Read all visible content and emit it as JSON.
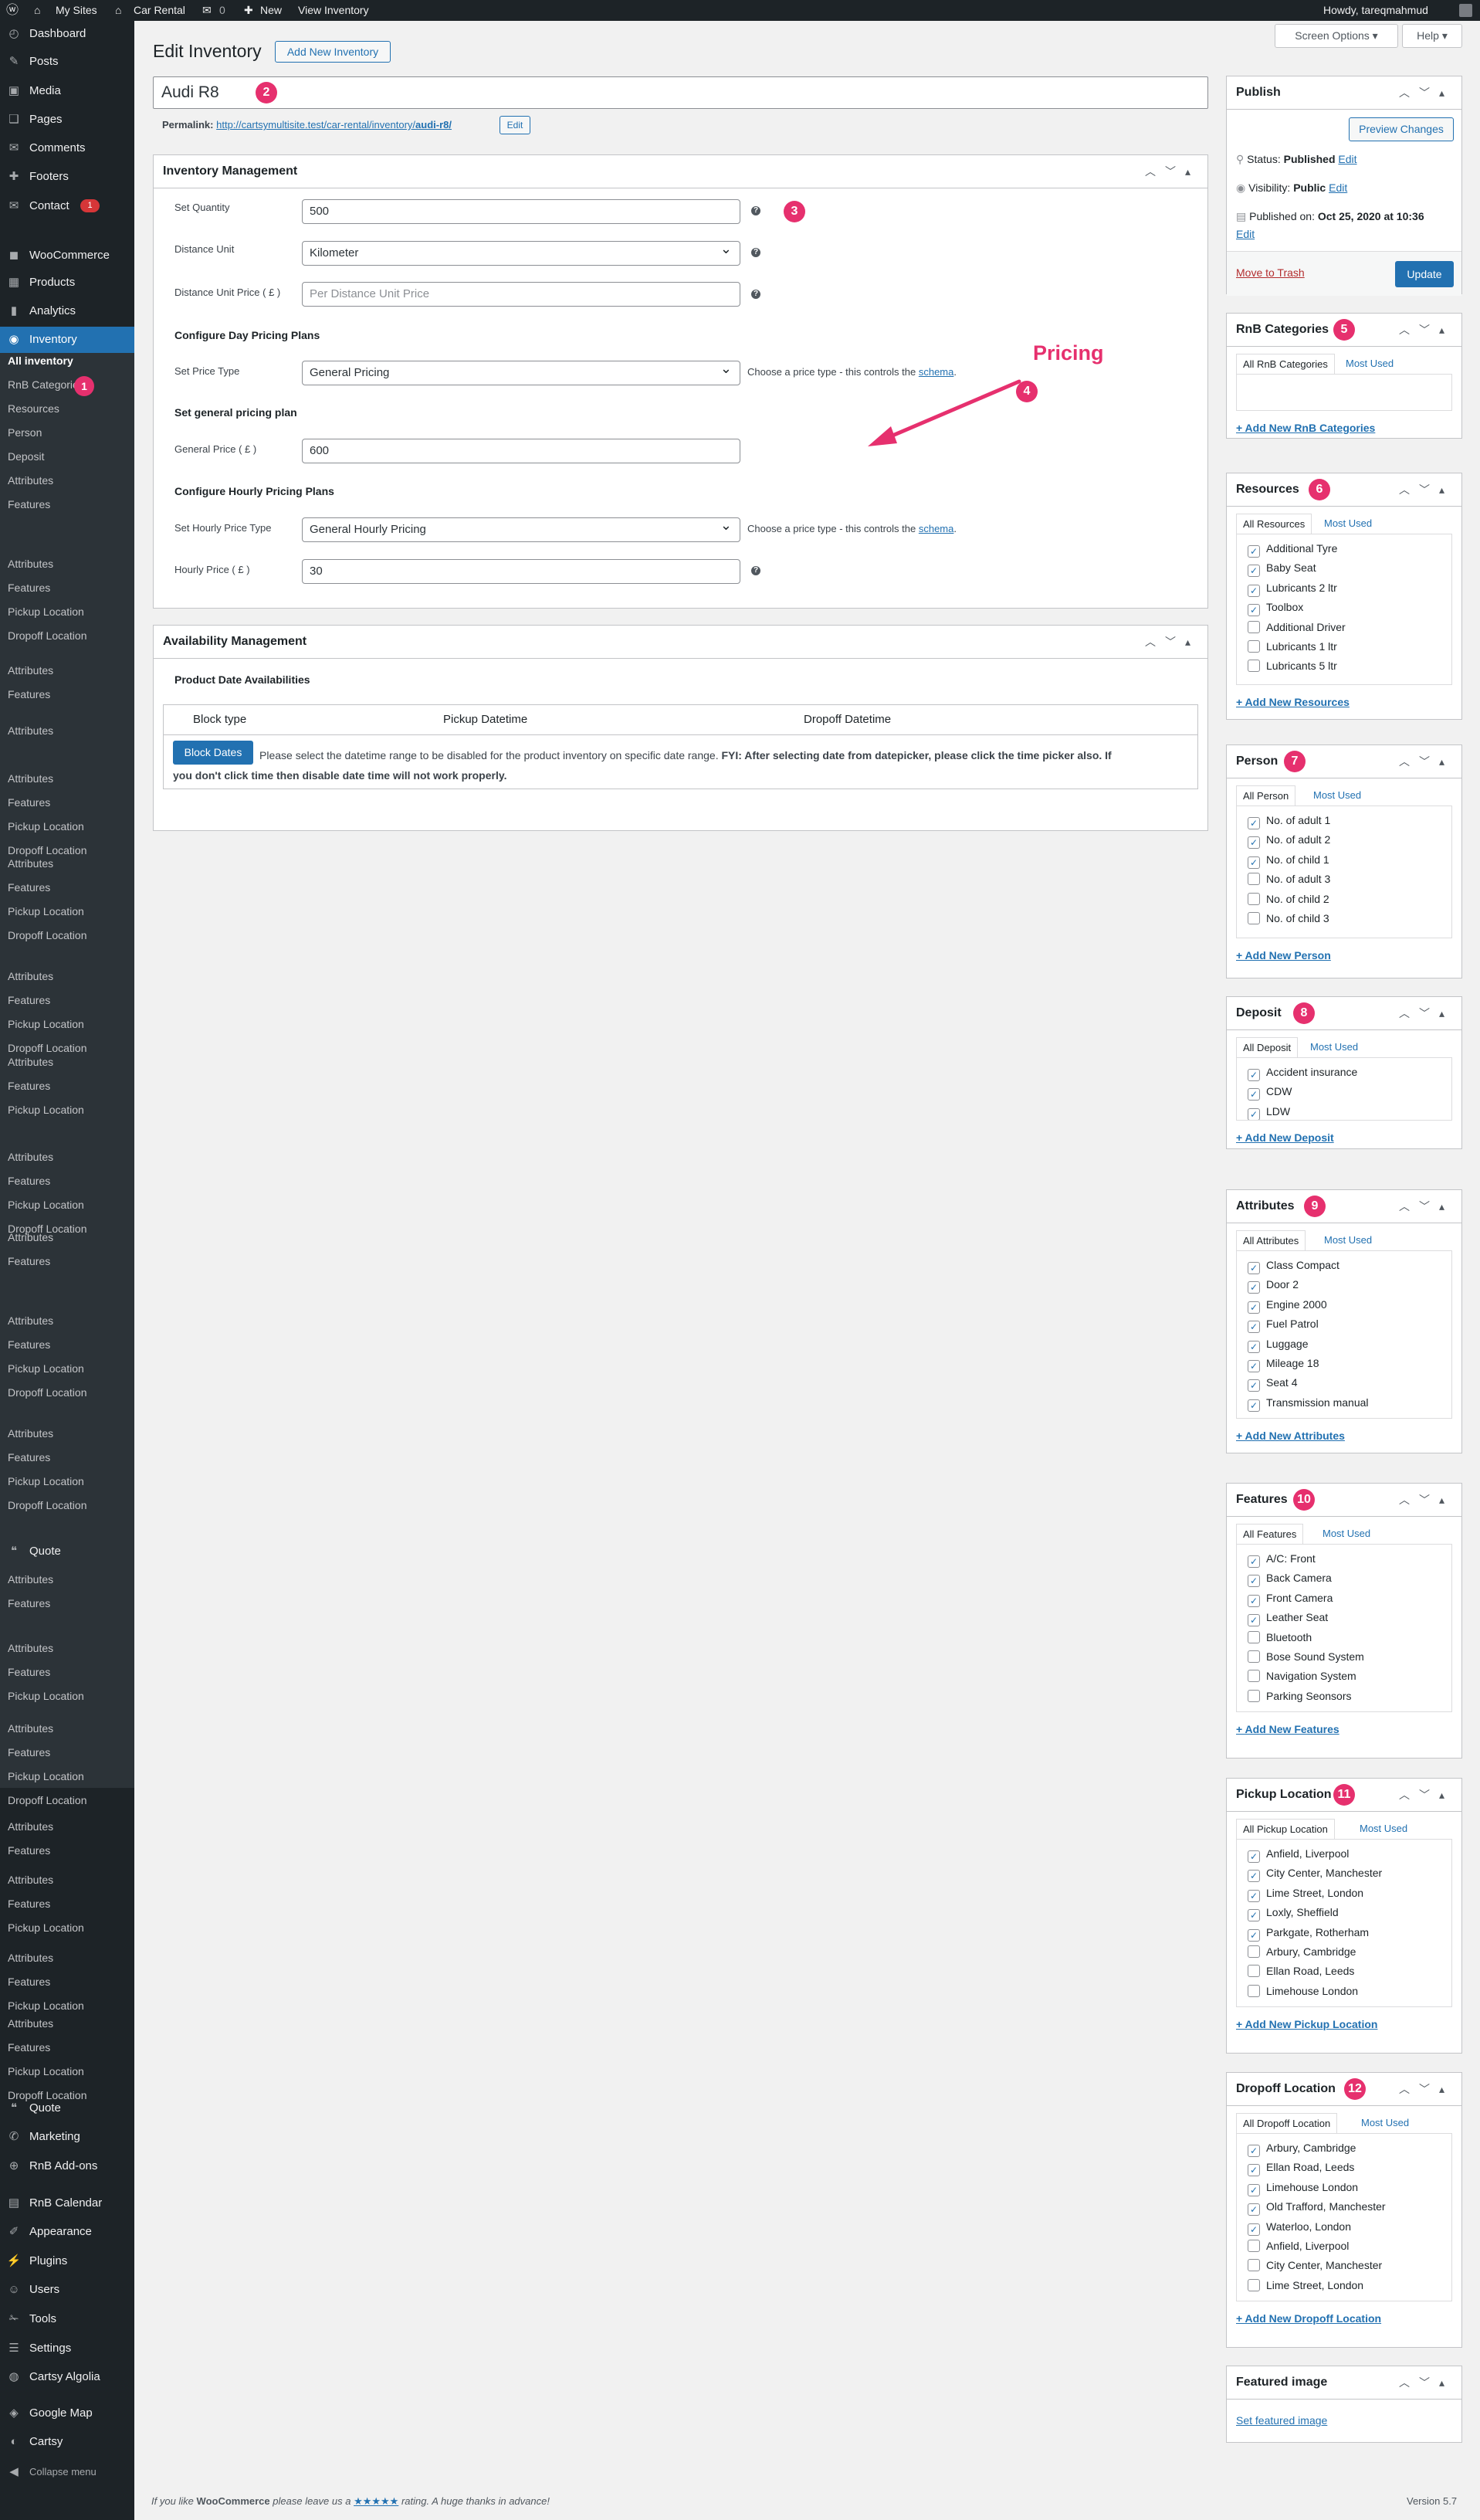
{
  "adminbar": {
    "my_sites": "My Sites",
    "site": "Car Rental",
    "comments": "0",
    "new": "New",
    "view": "View Inventory",
    "howdy": "Howdy, tareqmahmud"
  },
  "screen_options": "Screen Options ▾",
  "help": "Help ▾",
  "sidebar": {
    "top": [
      {
        "label": "Dashboard",
        "icon": "dashboard-icon",
        "glyph": "◴"
      },
      {
        "label": "Posts",
        "icon": "pin-icon",
        "glyph": "✎"
      },
      {
        "label": "Media",
        "icon": "media-icon",
        "glyph": "▣"
      },
      {
        "label": "Pages",
        "icon": "pages-icon",
        "glyph": "❑"
      },
      {
        "label": "Comments",
        "icon": "comments-icon",
        "glyph": "✉"
      },
      {
        "label": "Footers",
        "icon": "footers-icon",
        "glyph": "✚"
      },
      {
        "label": "Contact",
        "icon": "contact-icon",
        "glyph": "✉",
        "badge": "1"
      },
      {
        "label": "WooCommerce",
        "icon": "woocommerce-icon",
        "glyph": "◼"
      },
      {
        "label": "Products",
        "icon": "products-icon",
        "glyph": "▦"
      },
      {
        "label": "Analytics",
        "icon": "analytics-icon",
        "glyph": "▮"
      },
      {
        "label": "Inventory",
        "icon": "inventory-icon",
        "glyph": "◉",
        "active": true
      }
    ],
    "inventory_sub": [
      "All inventory",
      "RnB Categories",
      "Resources",
      "Person",
      "Deposit",
      "Attributes",
      "Features"
    ],
    "repeat": [
      "Attributes",
      "Features",
      "Pickup Location",
      "Dropoff Location"
    ],
    "bottom": [
      {
        "label": "Quote",
        "icon": "quote-icon",
        "glyph": "❝"
      },
      {
        "label": "Marketing",
        "icon": "marketing-icon",
        "glyph": "✆"
      },
      {
        "label": "RnB Add-ons",
        "icon": "addons-icon",
        "glyph": "⊕"
      },
      {
        "label": "RnB Calendar",
        "icon": "calendar-icon",
        "glyph": "▤"
      },
      {
        "label": "Appearance",
        "icon": "appearance-icon",
        "glyph": "✐"
      },
      {
        "label": "Plugins",
        "icon": "plugins-icon",
        "glyph": "⚡"
      },
      {
        "label": "Users",
        "icon": "users-icon",
        "glyph": "☺"
      },
      {
        "label": "Tools",
        "icon": "tools-icon",
        "glyph": "✁"
      },
      {
        "label": "Settings",
        "icon": "settings-icon",
        "glyph": "☰"
      },
      {
        "label": "Cartsy Algolia",
        "icon": "algolia-icon",
        "glyph": "◍"
      },
      {
        "label": "Google Map",
        "icon": "map-icon",
        "glyph": "◈"
      },
      {
        "label": "Cartsy",
        "icon": "cartsy-icon",
        "glyph": "◐"
      },
      {
        "label": "Collapse menu",
        "icon": "collapse-icon",
        "glyph": "◀"
      }
    ],
    "quote_mid": "Quote"
  },
  "page": {
    "title": "Edit Inventory",
    "add_new": "Add New Inventory",
    "post_title": "Audi R8",
    "permalink_label": "Permalink:",
    "permalink_url": "http://cartsymultisite.test/car-rental/inventory/",
    "permalink_slug": "audi-r8/",
    "edit": "Edit"
  },
  "inventory": {
    "title": "Inventory Management",
    "quantity_label": "Set Quantity",
    "quantity": "500",
    "distance_unit_label": "Distance Unit",
    "distance_unit": "Kilometer",
    "distance_price_label": "Distance Unit Price ( £ )",
    "distance_price_ph": "Per Distance Unit Price",
    "day_plans": "Configure Day Pricing Plans",
    "price_type_label": "Set Price Type",
    "price_type": "General Pricing",
    "price_note": "Choose a price type - this controls the ",
    "schema": "schema",
    "general_plan": "Set general pricing plan",
    "general_price_label": "General Price ( £ )",
    "general_price": "600",
    "hourly_plans": "Configure Hourly Pricing Plans",
    "hourly_type_label": "Set Hourly Price Type",
    "hourly_type": "General Hourly Pricing",
    "hourly_price_label": "Hourly Price ( £ )",
    "hourly_price": "30"
  },
  "annotation": {
    "pricing": "Pricing"
  },
  "availability": {
    "title": "Availability Management",
    "subtitle": "Product Date Availabilities",
    "cols": [
      "Block type",
      "Pickup Datetime",
      "Dropoff Datetime"
    ],
    "button": "Block Dates",
    "text1": "Please select the datetime range to be disabled for the product inventory on specific date range. ",
    "bold1": "FYI: After selecting date from datepicker, please click the time picker also. If",
    "bold2": "you don't click time then disable date time will not work properly."
  },
  "publish": {
    "title": "Publish",
    "preview": "Preview Changes",
    "status_label": "Status: ",
    "status": "Published",
    "visibility_label": "Visibility: ",
    "visibility": "Public",
    "published_label": "Published on: ",
    "published": "Oct 25, 2020 at 10:36",
    "edit": "Edit",
    "trash": "Move to Trash",
    "update": "Update"
  },
  "boxes": [
    {
      "title": "RnB Categories",
      "n": "5",
      "tab_all": "All RnB Categories",
      "most_used": "Most Used",
      "items": [],
      "add": "+ Add New RnB Categories"
    },
    {
      "title": "Resources",
      "n": "6",
      "tab_all": "All Resources",
      "most_used": "Most Used",
      "items": [
        [
          "Additional Tyre",
          true
        ],
        [
          "Baby Seat",
          true
        ],
        [
          "Lubricants 2 ltr",
          true
        ],
        [
          "Toolbox",
          true
        ],
        [
          "Additional Driver",
          false
        ],
        [
          "Lubricants 1 ltr",
          false
        ],
        [
          "Lubricants 5 ltr",
          false
        ]
      ],
      "add": "+ Add New Resources"
    },
    {
      "title": "Person",
      "n": "7",
      "tab_all": "All Person",
      "most_used": "Most Used",
      "items": [
        [
          "No. of adult 1",
          true
        ],
        [
          "No. of adult 2",
          true
        ],
        [
          "No. of child 1",
          true
        ],
        [
          "No. of adult 3",
          false
        ],
        [
          "No. of child 2",
          false
        ],
        [
          "No. of child 3",
          false
        ]
      ],
      "add": "+ Add New Person"
    },
    {
      "title": "Deposit",
      "n": "8",
      "tab_all": "All Deposit",
      "most_used": "Most Used",
      "items": [
        [
          "Accident insurance",
          true
        ],
        [
          "CDW",
          true
        ],
        [
          "LDW",
          true
        ]
      ],
      "add": "+ Add New Deposit"
    },
    {
      "title": "Attributes",
      "n": "9",
      "tab_all": "All Attributes",
      "most_used": "Most Used",
      "items": [
        [
          "Class Compact",
          true
        ],
        [
          "Door 2",
          true
        ],
        [
          "Engine 2000",
          true
        ],
        [
          "Fuel Patrol",
          true
        ],
        [
          "Luggage",
          true
        ],
        [
          "Mileage 18",
          true
        ],
        [
          "Seat 4",
          true
        ],
        [
          "Transmission manual",
          true
        ]
      ],
      "add": "+ Add New Attributes"
    },
    {
      "title": "Features",
      "n": "10",
      "tab_all": "All Features",
      "most_used": "Most Used",
      "items": [
        [
          "A/C: Front",
          true
        ],
        [
          "Back Camera",
          true
        ],
        [
          "Front Camera",
          true
        ],
        [
          "Leather Seat",
          true
        ],
        [
          "Bluetooth",
          false
        ],
        [
          "Bose Sound System",
          false
        ],
        [
          "Navigation System",
          false
        ],
        [
          "Parking Seonsors",
          false
        ]
      ],
      "add": "+ Add New Features"
    },
    {
      "title": "Pickup Location",
      "n": "11",
      "tab_all": "All Pickup Location",
      "most_used": "Most Used",
      "items": [
        [
          "Anfield, Liverpool",
          true
        ],
        [
          "City Center, Manchester",
          true
        ],
        [
          "Lime Street, London",
          true
        ],
        [
          "Loxly, Sheffield",
          true
        ],
        [
          "Parkgate, Rotherham",
          true
        ],
        [
          "Arbury, Cambridge",
          false
        ],
        [
          "Ellan Road, Leeds",
          false
        ],
        [
          "Limehouse London",
          false
        ]
      ],
      "add": "+ Add New Pickup Location"
    },
    {
      "title": "Dropoff Location",
      "n": "12",
      "tab_all": "All Dropoff Location",
      "most_used": "Most Used",
      "items": [
        [
          "Arbury, Cambridge",
          true
        ],
        [
          "Ellan Road, Leeds",
          true
        ],
        [
          "Limehouse London",
          true
        ],
        [
          "Old Trafford, Manchester",
          true
        ],
        [
          "Waterloo, London",
          true
        ],
        [
          "Anfield, Liverpool",
          false
        ],
        [
          "City Center, Manchester",
          false
        ],
        [
          "Lime Street, London",
          false
        ]
      ],
      "add": "+ Add New Dropoff Location"
    }
  ],
  "featured": {
    "title": "Featured image",
    "link": "Set featured image"
  },
  "footer": {
    "pre": "If you like ",
    "woo": "WooCommerce",
    "mid": " please leave us a ",
    "stars": "★★★★★",
    "post": " rating. A huge thanks in advance!",
    "version": "Version 5.7"
  },
  "colors": {
    "accent": "#2271b1",
    "annotation": "#e6306e",
    "sidebar": "#1d2327"
  }
}
